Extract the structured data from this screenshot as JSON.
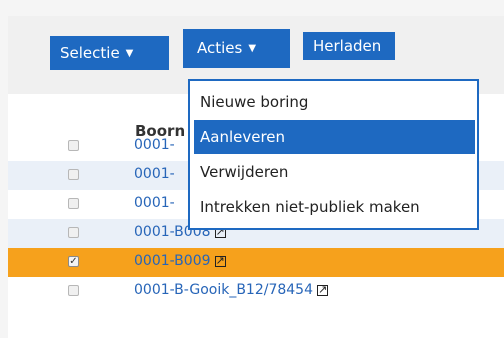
{
  "toolbar": {
    "selectie_label": "Selectie",
    "acties_label": "Acties",
    "herladen_label": "Herladen"
  },
  "table": {
    "column_header": "Boorn",
    "rows": [
      {
        "id": "0001-",
        "checked": false
      },
      {
        "id": "0001-",
        "checked": false
      },
      {
        "id": "0001-",
        "checked": false
      },
      {
        "id": "0001-B008",
        "checked": false
      },
      {
        "id": "0001-B009",
        "checked": true
      },
      {
        "id": "0001-B-Gooik_B12/78454",
        "checked": false
      }
    ]
  },
  "menu": {
    "items": [
      "Nieuwe boring",
      "Aanleveren",
      "Verwijderen",
      "Intrekken niet-publiek maken"
    ],
    "highlighted": "Aanleveren"
  },
  "colors": {
    "primary": "#1e69c1",
    "selected_row": "#f6a11c",
    "link": "#2765b8"
  },
  "icons": {
    "dropdown": "caret-down-icon",
    "external": "external-link-icon"
  }
}
